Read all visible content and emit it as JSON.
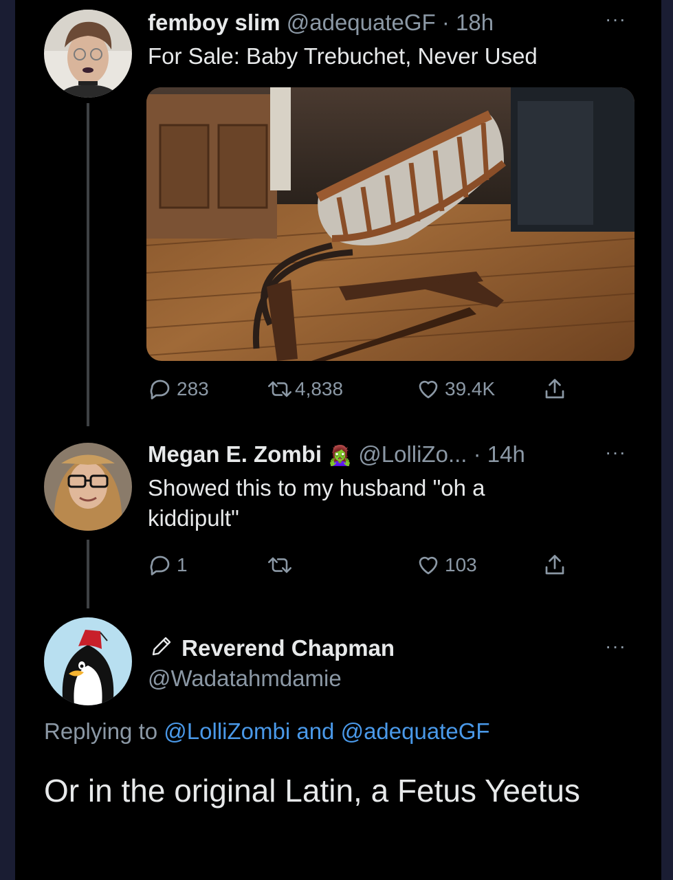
{
  "tweet1": {
    "name": "femboy slim",
    "handle": "@adequateGF",
    "separator": "·",
    "time": "18h",
    "more": "···",
    "text": "For Sale: Baby Trebuchet, Never Used",
    "replies": "283",
    "retweets": "4,838",
    "likes": "39.4K"
  },
  "tweet2": {
    "name": "Megan E. Zombi",
    "emoji": "🧟‍♀️",
    "handle": "@LolliZo...",
    "separator": "·",
    "time": "14h",
    "more": "···",
    "text": "Showed this to my husband \"oh a kiddipult\"",
    "replies": "1",
    "retweets": "",
    "likes": "103"
  },
  "tweet3": {
    "name": "Reverend Chapman",
    "handle": "@Wadatahmdamie",
    "more": "···",
    "replying_prefix": "Replying to",
    "replying_user1": "@LolliZombi",
    "replying_and": "and",
    "replying_user2": "@adequateGF",
    "text": "Or in the original Latin, a Fetus Yeetus"
  },
  "icons": {
    "reply": "reply-icon",
    "retweet": "retweet-icon",
    "like": "heart-icon",
    "share": "share-icon",
    "verified_like": "pencil-icon"
  },
  "colors": {
    "background": "#000000",
    "text": "#e7e9ea",
    "muted": "#8b98a5",
    "link": "#4a99e9"
  }
}
